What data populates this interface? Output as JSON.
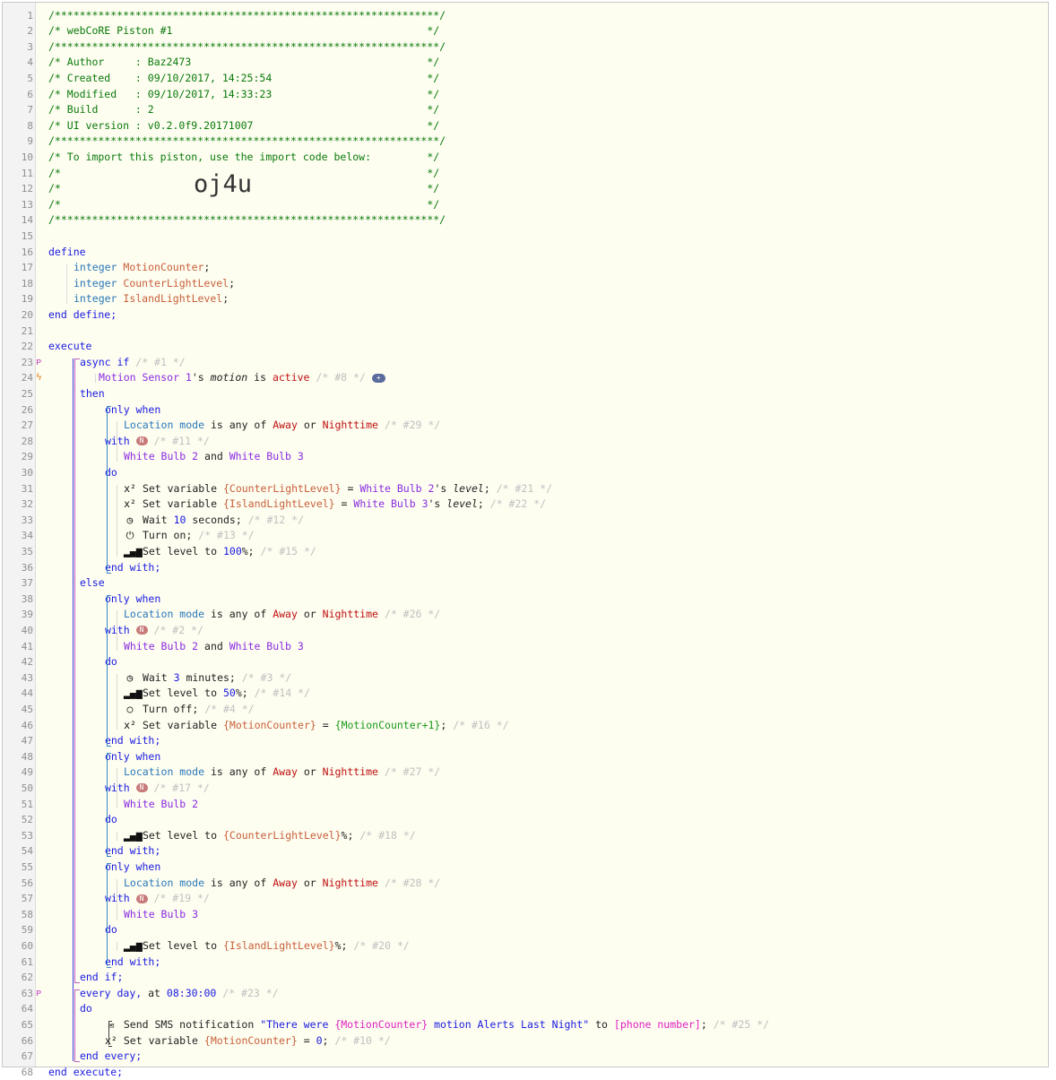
{
  "header": {
    "border": "/**************************************************************/",
    "lines": [
      "/* webCoRE Piston #1                                         */",
      "/* Author     : Baz2473                                      */",
      "/* Created    : 09/10/2017, 14:25:54                         */",
      "/* Modified   : 09/10/2017, 14:33:23                         */",
      "/* Build      : 2                                            */",
      "/* UI version : v0.2.0f9.20171007                            */",
      "/* To import this piston, use the import code below:         */",
      "/*                                                           */",
      "/*                                                           */",
      "/*                                                           */"
    ],
    "import_code": "oj4u"
  },
  "define": {
    "open": "define",
    "type": "integer",
    "vars": [
      "MotionCounter",
      "CounterLightLevel",
      "IslandLightLevel"
    ],
    "close": "end define;"
  },
  "execute": {
    "open": "execute",
    "close": "end execute;",
    "async_if": "async if",
    "id1": "/* #1 */",
    "trigger_device": "Motion Sensor 1",
    "trigger_s": "'s",
    "trigger_attr": "motion",
    "is": "is",
    "trigger_value": "active",
    "id8": "/* #8 */",
    "plus": "+",
    "then": "then",
    "else": "else",
    "end_if": "end if;",
    "only_when": "only when",
    "location_mode": "Location mode",
    "is_any_of": "is any of",
    "away": "Away",
    "or": "or",
    "nighttime": "Nighttime",
    "with": "with",
    "n_badge": "N",
    "and": "and",
    "do": "do",
    "end_with": "end with;",
    "wb2": "White Bulb 2",
    "wb3": "White Bulb 3",
    "set_variable": "Set variable",
    "eq": "=",
    "level": "level",
    "semicolon": ";",
    "id29": "/* #29 */",
    "id11": "/* #11 */",
    "id21": "/* #21 */",
    "id22": "/* #22 */",
    "id12": "/* #12 */",
    "id13": "/* #13 */",
    "id15": "/* #15 */",
    "id26": "/* #26 */",
    "id2": "/* #2 */",
    "id3": "/* #3 */",
    "id14": "/* #14 */",
    "id4": "/* #4 */",
    "id16": "/* #16 */",
    "id27": "/* #27 */",
    "id17": "/* #17 */",
    "id18": "/* #18 */",
    "id28": "/* #28 */",
    "id19": "/* #19 */",
    "id20": "/* #20 */",
    "id23": "/* #23 */",
    "id25": "/* #25 */",
    "id10": "/* #10 */",
    "wait": "Wait",
    "ten": "10",
    "seconds": "seconds;",
    "three": "3",
    "minutes": "minutes;",
    "turn_on": "Turn on;",
    "turn_off": "Turn off;",
    "set_level_to": "Set level to",
    "l100": "100",
    "l50": "50",
    "pct": "%;",
    "v_counter": "{CounterLightLevel}",
    "v_island": "{IslandLightLevel}",
    "v_motion": "{MotionCounter}",
    "v_motion_plus": "{MotionCounter+1}",
    "every_day": "every day,",
    "at": "at",
    "time": "08:30:00",
    "send_sms": "Send SMS notification",
    "sms_msg_a": "\"There were ",
    "sms_msg_var": "{MotionCounter}",
    "sms_msg_b": " motion Alerts Last Night\"",
    "to": "to",
    "phone": "[phone number]",
    "zero": "0",
    "end_every": "end every;"
  }
}
